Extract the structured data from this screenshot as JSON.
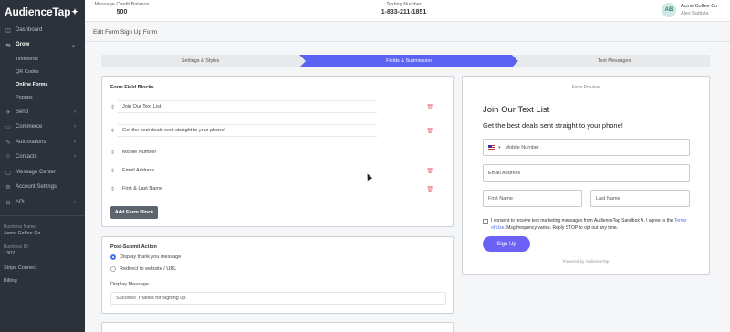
{
  "brand": {
    "logo_text": "AudienceTap",
    "logo_mark": "✦"
  },
  "sidebar": {
    "items": [
      {
        "label": "Dashboard",
        "icon": "dashboard-icon",
        "glyph": "◫",
        "chevron": ""
      },
      {
        "label": "Grow",
        "icon": "grow-icon",
        "glyph": "⇋",
        "chevron": "⌄"
      },
      {
        "label": "Send",
        "icon": "send-icon",
        "glyph": "✈",
        "chevron": "›"
      },
      {
        "label": "Commerce",
        "icon": "commerce-icon",
        "glyph": "▭",
        "chevron": "›"
      },
      {
        "label": "Automations",
        "icon": "automations-icon",
        "glyph": "✎",
        "chevron": "›"
      },
      {
        "label": "Contacts",
        "icon": "contacts-icon",
        "glyph": "☺",
        "chevron": "›"
      },
      {
        "label": "Message Center",
        "icon": "message-center-icon",
        "glyph": "▢",
        "chevron": ""
      },
      {
        "label": "Account Settings",
        "icon": "account-settings-icon",
        "glyph": "⚙",
        "chevron": ""
      },
      {
        "label": "API",
        "icon": "api-icon",
        "glyph": "⊡",
        "chevron": "›"
      }
    ],
    "grow_sub": [
      "Textwords",
      "QR Codes",
      "Online Forms",
      "Popups"
    ],
    "business_name_label": "Business Name",
    "business_name": "Acme Coffee Co",
    "business_id_label": "Business ID",
    "business_id": "1302",
    "stripe_connect": "Stripe Connect",
    "billing": "Billing"
  },
  "header": {
    "credit_label": "Message Credit Balance",
    "credit_value": "500",
    "texting_label": "Texting Number",
    "texting_value": "1-833-211-1851",
    "avatar_initials": "AB",
    "account_name": "Acme Coffee Co",
    "user_name": "Alex Battista"
  },
  "page": {
    "title": "Edit Form Sign Up Form"
  },
  "stepper": {
    "steps": [
      "Settings & Styles",
      "Fields & Submission",
      "Text Messages"
    ],
    "active_index": 1,
    "accent": "#5b63f3"
  },
  "form_field_blocks": {
    "heading": "Form Field Blocks",
    "blocks": [
      "Join Our Text List",
      "Get the best deals sent straight to your phone!",
      "Mobile Number",
      "Email Address",
      "First & Last Name"
    ],
    "add_button": "Add Form Block"
  },
  "post_submit": {
    "heading": "Post-Submit Action",
    "options": [
      "Display thank you message",
      "Redirect to website / URL"
    ],
    "selected_index": 0,
    "display_message_label": "Display Message",
    "display_message_value": "Success! Thanks for signing up."
  },
  "preview": {
    "label": "Form Preview",
    "title": "Join Our Text List",
    "subtitle": "Get the best deals sent straight to your phone!",
    "mobile_placeholder": "Mobile Number",
    "country_dropdown": "▾",
    "email_placeholder": "Email Address",
    "first_name_placeholder": "First Name",
    "last_name_placeholder": "Last Name",
    "consent_text_1": "I consent to receive text marketing messages from AudienceTap Sandbox A. I agree to the",
    "terms_link": "Terms of Use",
    "consent_text_2": ". Msg frequency varies. Reply STOP to opt out any time.",
    "signup_button": "Sign Up",
    "powered_by": "Powered by AudienceTap"
  },
  "colors": {
    "sidebar_bg": "#2b323b",
    "accent": "#5b63f3",
    "button_primary": "#6b62f5",
    "trash": "#e0707a"
  }
}
